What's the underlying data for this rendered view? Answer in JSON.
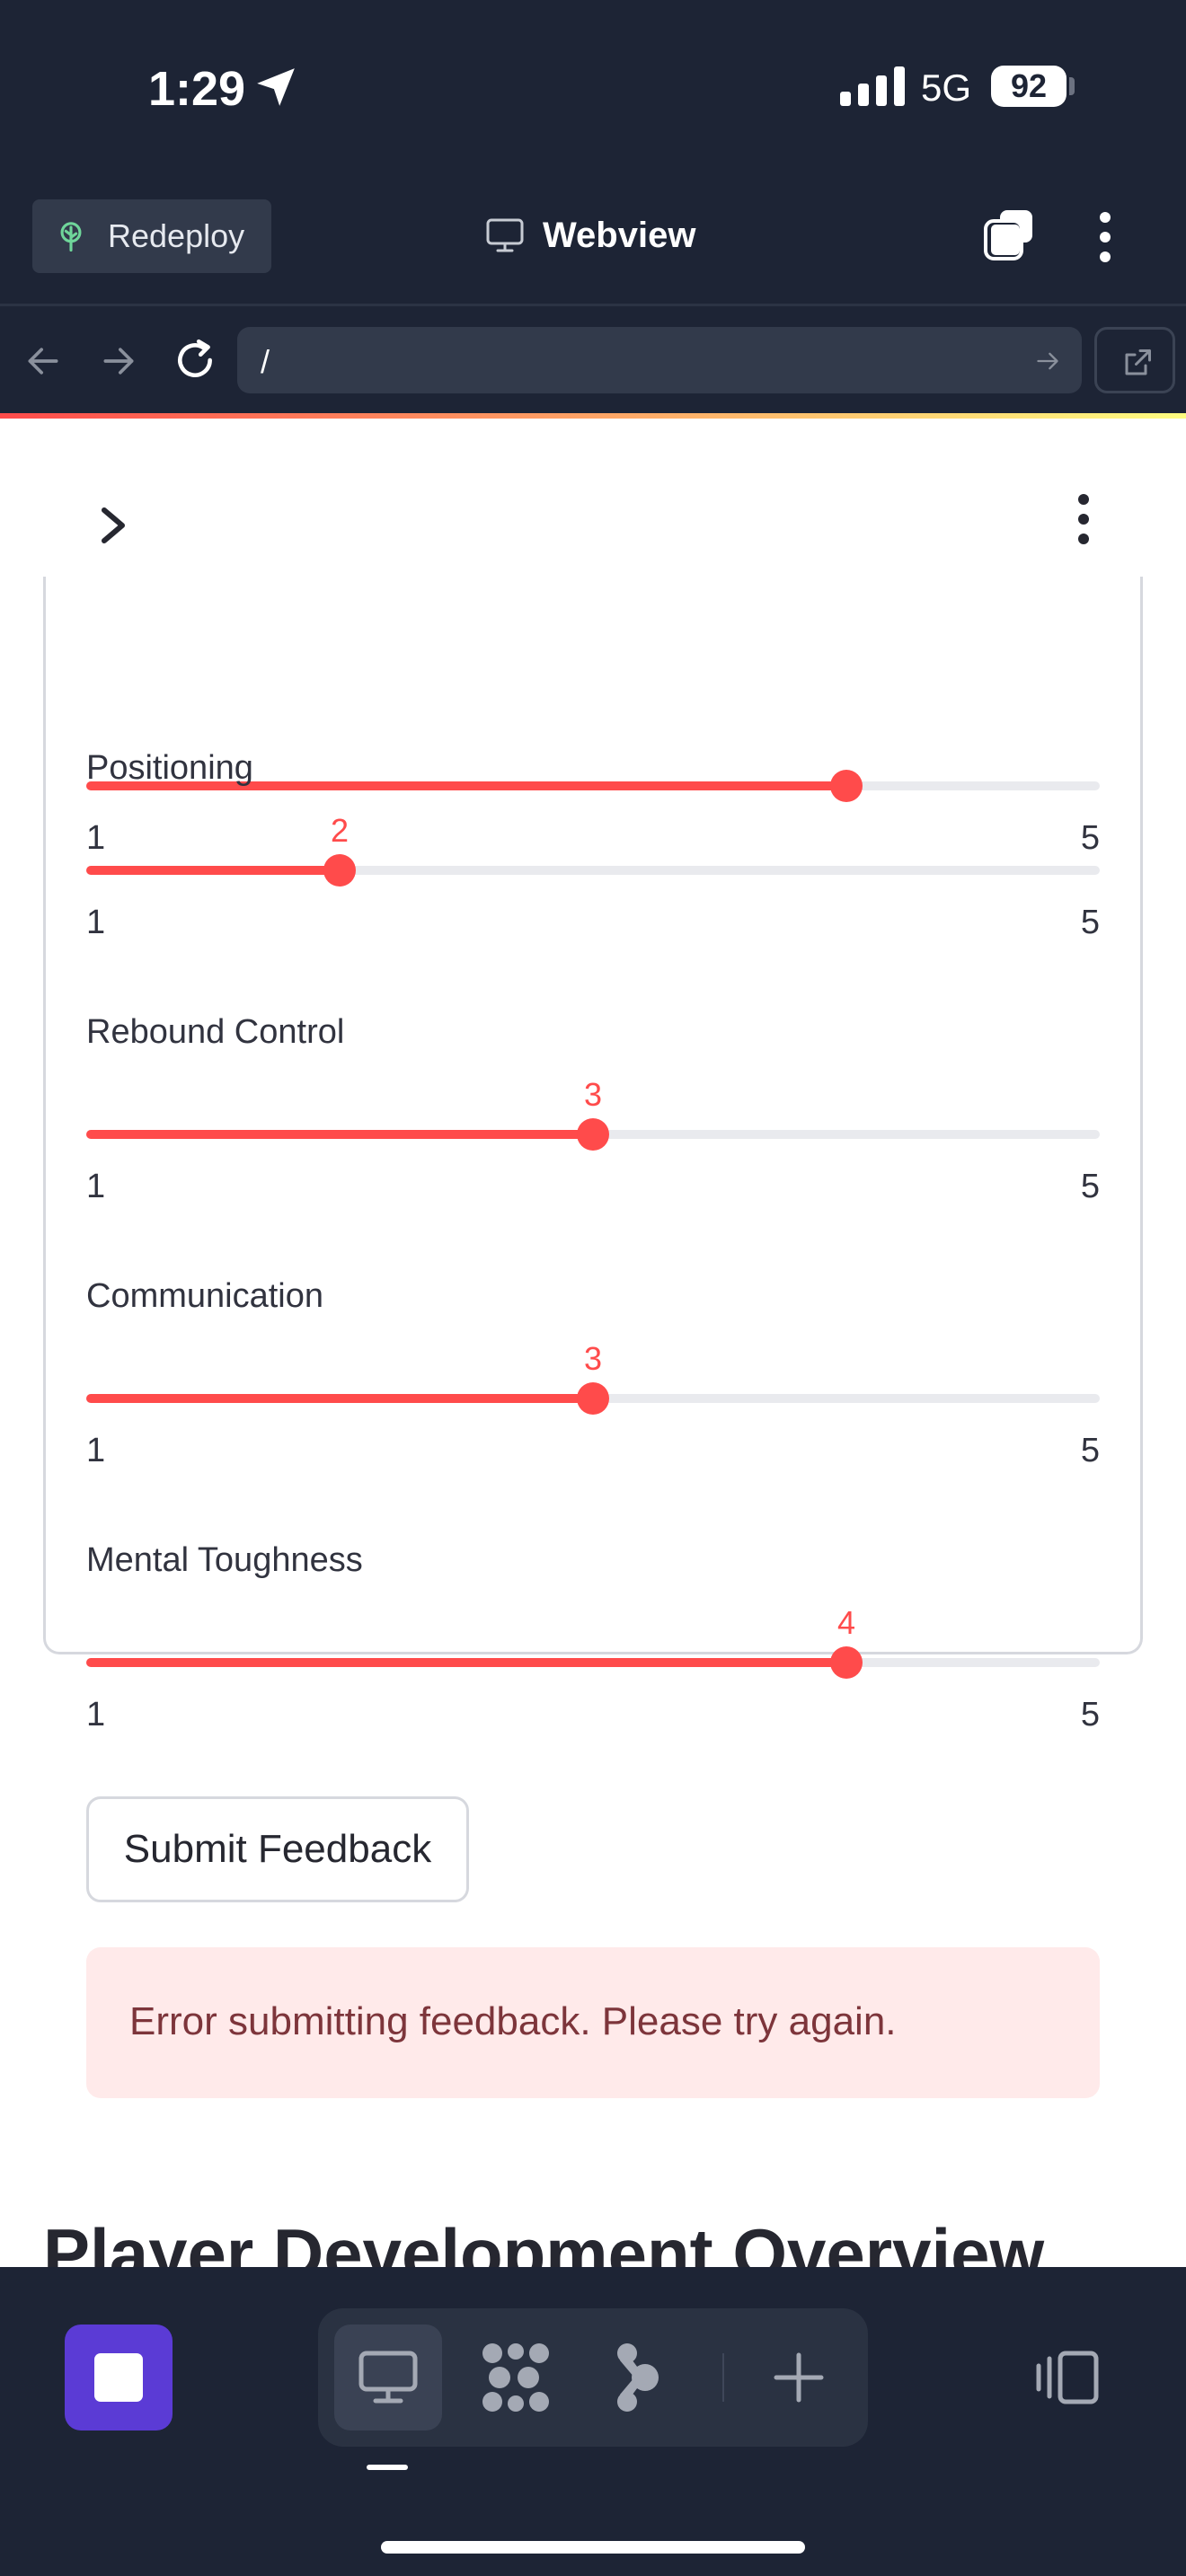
{
  "status_bar": {
    "time": "1:29",
    "network": "5G",
    "battery": "92"
  },
  "header": {
    "redeploy_label": "Redeploy",
    "title": "Webview"
  },
  "browser": {
    "url": "/"
  },
  "sliders": [
    {
      "label": "",
      "value": 4,
      "value_label": "",
      "min": "1",
      "max": "5",
      "min_value": 1,
      "max_value": 5
    },
    {
      "label": "Positioning",
      "value": 2,
      "value_label": "2",
      "min": "1",
      "max": "5",
      "min_value": 1,
      "max_value": 5
    },
    {
      "label": "Rebound Control",
      "value": 3,
      "value_label": "3",
      "min": "1",
      "max": "5",
      "min_value": 1,
      "max_value": 5
    },
    {
      "label": "Communication",
      "value": 3,
      "value_label": "3",
      "min": "1",
      "max": "5",
      "min_value": 1,
      "max_value": 5
    },
    {
      "label": "Mental Toughness",
      "value": 4,
      "value_label": "4",
      "min": "1",
      "max": "5",
      "min_value": 1,
      "max_value": 5
    }
  ],
  "form": {
    "submit_label": "Submit Feedback",
    "error_message": "Error submitting feedback. Please try again."
  },
  "section": {
    "heading": "Player Development Overview"
  },
  "colors": {
    "accent": "#ff4b4b",
    "chrome": "#1d2435",
    "stop": "#5b3bd5",
    "error_bg": "#ffeaea"
  },
  "icons": {
    "status": [
      "location-arrow-icon",
      "signal-icon"
    ],
    "header": [
      "tree-icon",
      "monitor-icon",
      "tabs-icon",
      "more-vertical-icon"
    ],
    "nav": [
      "back-arrow-icon",
      "forward-arrow-icon",
      "reload-icon",
      "go-arrow-icon",
      "external-link-icon"
    ],
    "toolbar": [
      "stop-icon",
      "desktop-icon",
      "grid-dots-icon",
      "connector-icon",
      "plus-icon",
      "panel-icon"
    ]
  }
}
